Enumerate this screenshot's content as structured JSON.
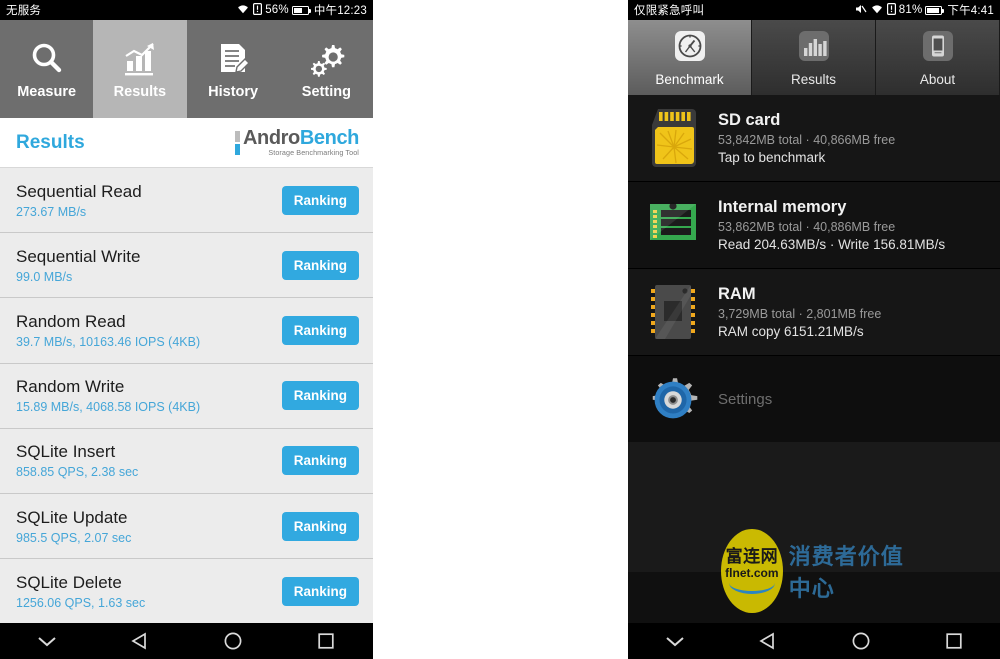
{
  "left_phone": {
    "statusbar": {
      "carrier": "无服务",
      "battery_pct": "56%",
      "clock": "中午12:23",
      "icons": [
        "wifi-icon",
        "sim-card-icon",
        "battery-icon"
      ]
    },
    "tabs": [
      {
        "label": "Measure",
        "icon": "magnifier-icon",
        "selected": false
      },
      {
        "label": "Results",
        "icon": "bar-chart-icon",
        "selected": true
      },
      {
        "label": "History",
        "icon": "document-pen-icon",
        "selected": false
      },
      {
        "label": "Setting",
        "icon": "gears-icon",
        "selected": false
      }
    ],
    "header": {
      "title": "Results",
      "logo_part1": "Andro",
      "logo_part2": "Bench",
      "logo_tagline": "Storage Benchmarking Tool"
    },
    "results": [
      {
        "name": "Sequential Read",
        "value": "273.67 MB/s",
        "button": "Ranking"
      },
      {
        "name": "Sequential Write",
        "value": "99.0 MB/s",
        "button": "Ranking"
      },
      {
        "name": "Random Read",
        "value": "39.7 MB/s, 10163.46 IOPS (4KB)",
        "button": "Ranking"
      },
      {
        "name": "Random Write",
        "value": "15.89 MB/s, 4068.58 IOPS (4KB)",
        "button": "Ranking"
      },
      {
        "name": "SQLite Insert",
        "value": "858.85 QPS, 2.38 sec",
        "button": "Ranking"
      },
      {
        "name": "SQLite Update",
        "value": "985.5 QPS, 2.07 sec",
        "button": "Ranking"
      },
      {
        "name": "SQLite Delete",
        "value": "1256.06 QPS, 1.63 sec",
        "button": "Ranking"
      }
    ],
    "navbar": [
      "chevron-down-icon",
      "back-triangle-icon",
      "home-circle-icon",
      "recents-square-icon"
    ]
  },
  "right_phone": {
    "statusbar": {
      "carrier": "仅限紧急呼叫",
      "battery_pct": "81%",
      "clock": "下午4:41",
      "icons": [
        "mute-icon",
        "wifi-icon",
        "sim-card-icon",
        "battery-icon"
      ]
    },
    "tabs": [
      {
        "label": "Benchmark",
        "icon": "speedometer-icon",
        "selected": true
      },
      {
        "label": "Results",
        "icon": "bar-chart-icon",
        "selected": false
      },
      {
        "label": "About",
        "icon": "phone-icon",
        "selected": false
      }
    ],
    "cards": [
      {
        "title": "SD card",
        "subtitle": "53,842MB total · 40,866MB free",
        "detail": "Tap to benchmark",
        "icon": "sd-card-icon"
      },
      {
        "title": "Internal memory",
        "subtitle": "53,862MB total · 40,886MB free",
        "detail": "Read 204.63MB/s · Write 156.81MB/s",
        "icon": "memory-chip-icon"
      },
      {
        "title": "RAM",
        "subtitle": "3,729MB total · 2,801MB free",
        "detail": "RAM copy 6151.21MB/s",
        "icon": "ram-chip-icon"
      }
    ],
    "settings": {
      "label": "Settings",
      "icon": "gear-icon"
    },
    "navbar": [
      "chevron-down-icon",
      "back-triangle-icon",
      "home-circle-icon",
      "recents-square-icon"
    ]
  },
  "watermark": {
    "logo_cn": "富连网",
    "logo_domain": "flnet.com",
    "slogan": "消费者价值中心"
  },
  "colors": {
    "accent_blue": "#31a9e0",
    "left_tabbar": "#6e6e6e",
    "left_tab_selected": "#b6b6b6",
    "left_list_bg": "#ececec",
    "right_bg": "#0e0e0e",
    "sd_yellow": "#e9b71d",
    "memory_green": "#3aa94a",
    "watermark_yellow": "#d9c800"
  }
}
